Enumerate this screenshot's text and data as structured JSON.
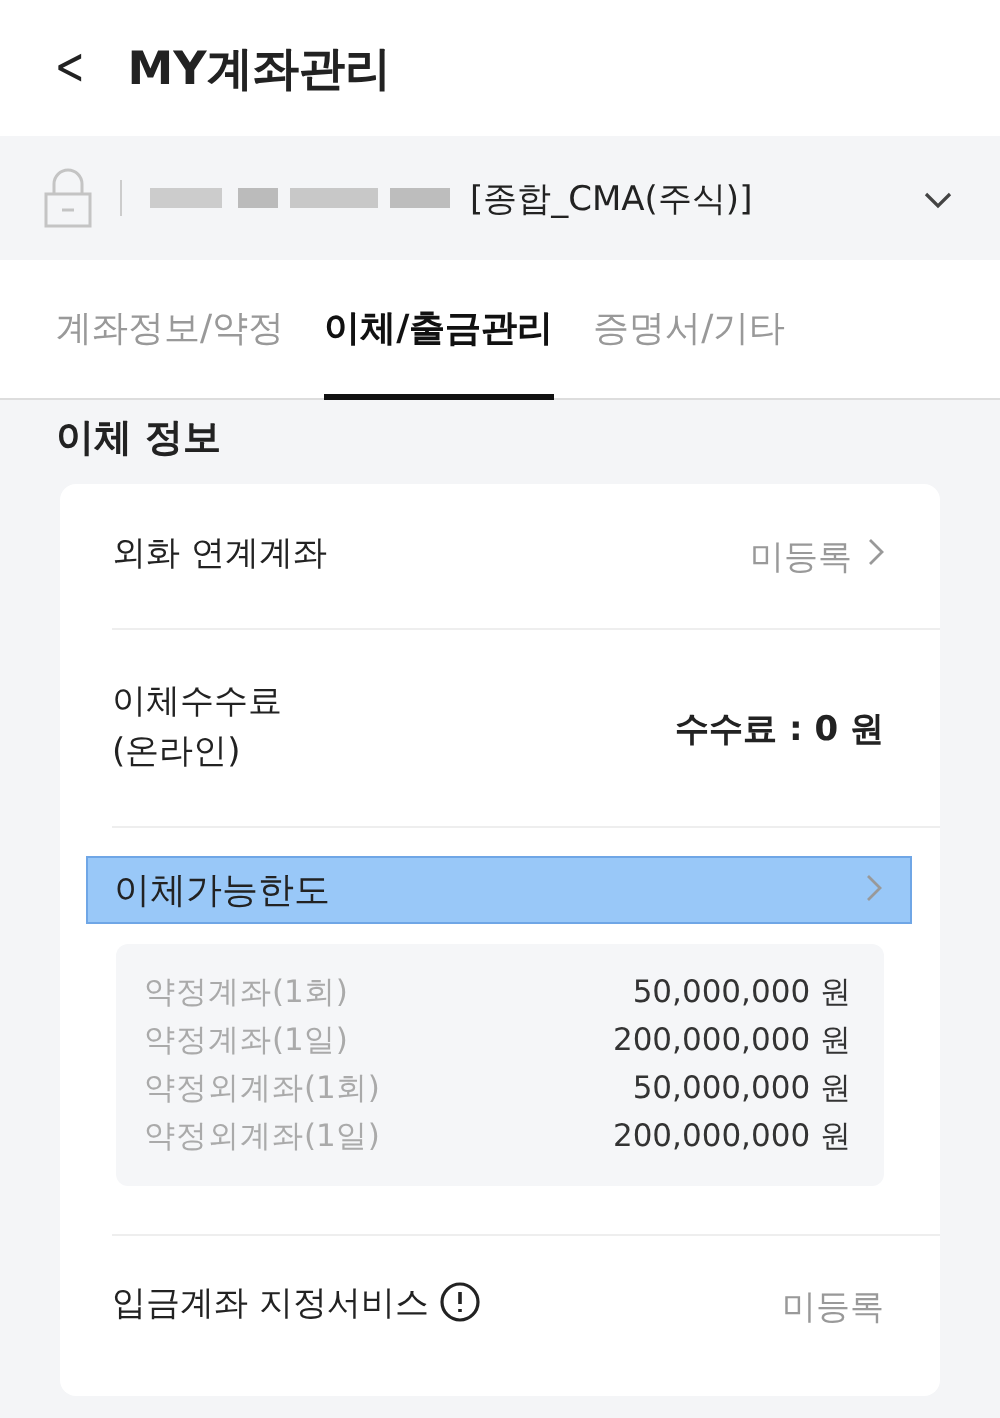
{
  "header": {
    "back": "<",
    "title": "MY계좌관리"
  },
  "account": {
    "type": "[종합_CMA(주식)]"
  },
  "tabs": [
    {
      "label": "계좌정보/약정",
      "selected": false
    },
    {
      "label": "이체/출금관리",
      "selected": true
    },
    {
      "label": "증명서/기타",
      "selected": false
    }
  ],
  "section_title": "이체 정보",
  "foreign_account": {
    "label": "외화 연계계좌",
    "value": "미등록"
  },
  "fee": {
    "label": "이체수수료\n(온라인)",
    "value": "수수료 : 0 원"
  },
  "limits": {
    "label": "이체가능한도",
    "highlighted": true,
    "rows": [
      {
        "label": "약정계좌(1회)",
        "amount": "50,000,000 원"
      },
      {
        "label": "약정계좌(1일)",
        "amount": "200,000,000 원"
      },
      {
        "label": "약정외계좌(1회)",
        "amount": "50,000,000 원"
      },
      {
        "label": "약정외계좌(1일)",
        "amount": "200,000,000 원"
      }
    ]
  },
  "deposit_service": {
    "label": "입금계좌 지정서비스",
    "value": "미등록"
  }
}
